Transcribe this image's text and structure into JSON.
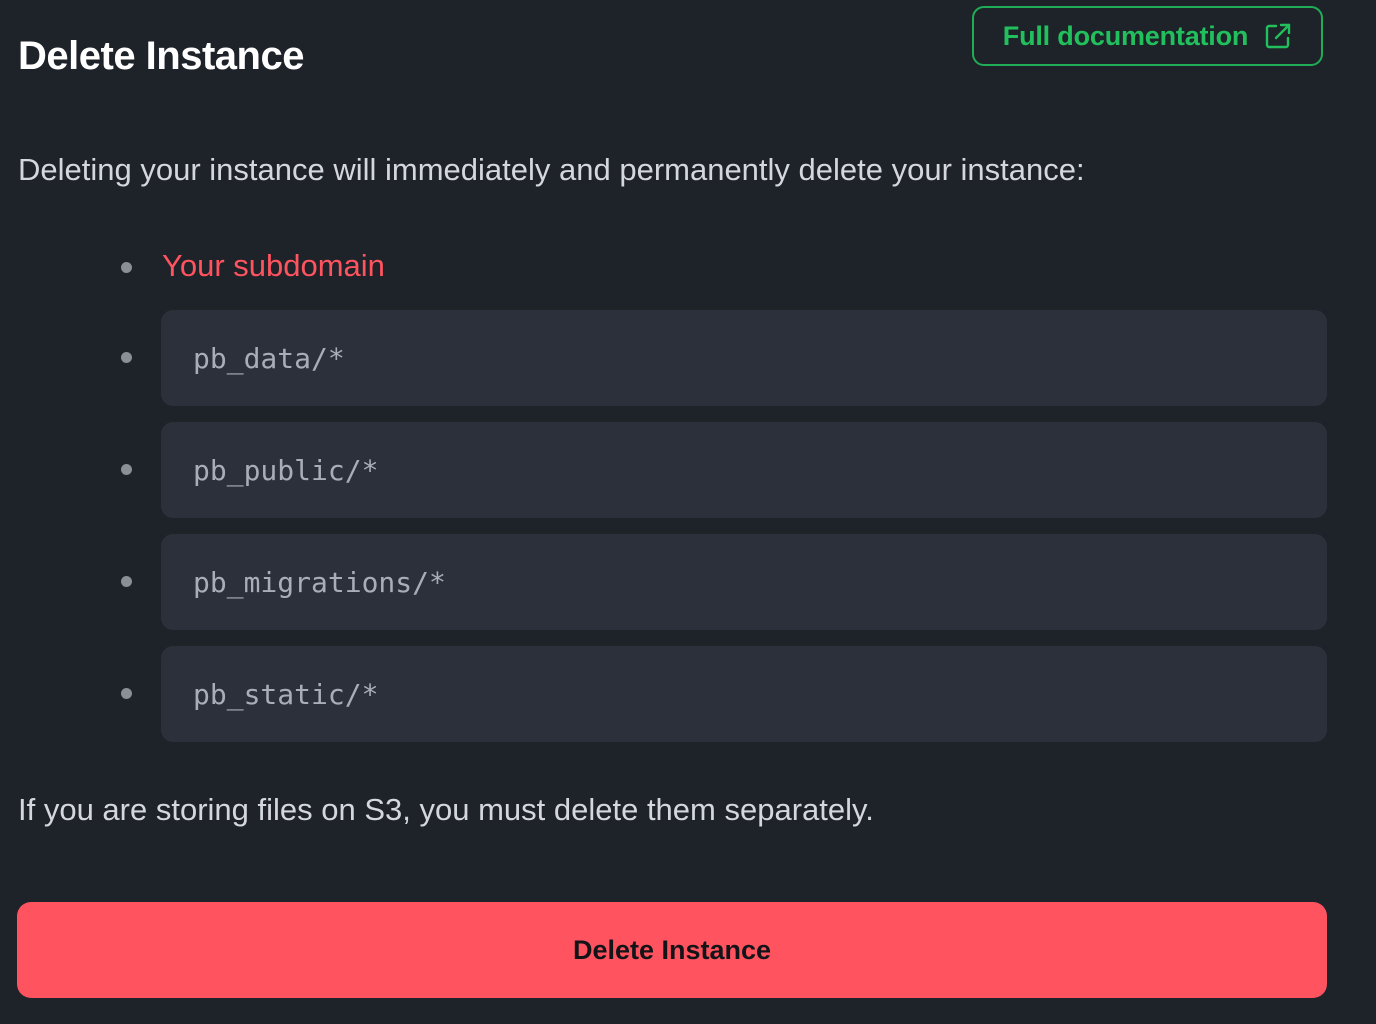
{
  "header": {
    "title": "Delete Instance",
    "docs_button_label": "Full documentation",
    "docs_icon": "external-link-icon"
  },
  "intro_text": "Deleting your instance will immediately and permanently delete your instance:",
  "items": {
    "subdomain": "Your subdomain",
    "paths": [
      "pb_data/*",
      "pb_public/*",
      "pb_migrations/*",
      "pb_static/*"
    ]
  },
  "note_text": "If you are storing files on S3, you must delete them separately.",
  "delete_button_label": "Delete Instance",
  "colors": {
    "background": "#1e2229",
    "accent_green": "#22c05d",
    "danger_red": "#ff5460",
    "code_background": "#2b303a"
  }
}
